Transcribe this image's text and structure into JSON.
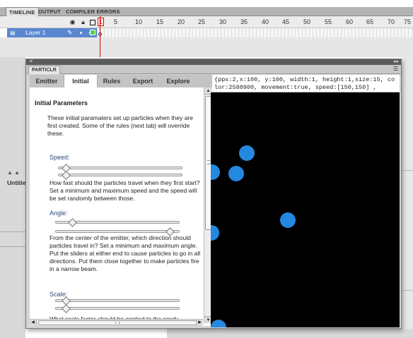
{
  "app": {
    "tabs": [
      "TIMELINE",
      "OUTPUT",
      "COMPILER ERRORS"
    ],
    "frame_numbers": [
      "1",
      "5",
      "10",
      "15",
      "20",
      "25",
      "30",
      "35",
      "40",
      "45",
      "50",
      "55",
      "60",
      "65",
      "70",
      "75"
    ],
    "layer_name": "Layer 1",
    "layer_color": "#4ed04e",
    "left_tab": "Untitle"
  },
  "window": {
    "tab_label": "PARTICLR",
    "nav_tabs": [
      "Emitter",
      "Initial",
      "Rules",
      "Export",
      "Explore"
    ],
    "active_tab": "Initial",
    "section_title": "Initial Parameters",
    "intro": "These initial paramaters set up particles when they are first created.  Some of the rules (next tab) will override these.",
    "speed": {
      "label": "Speed:",
      "description": "How fast should the particles travel when they first start?  Set a minimum and maximum speed and the speed will be set randomly between those."
    },
    "angle": {
      "label": "Angle:",
      "description": "From the center of the emitter, which direction should particles travel in?  Set a minimum and maximum angle.  Put the sliders at either end to cause particles to go in all directions.  Put them close together to make particles fire in a narrow beam."
    },
    "scale": {
      "label": "Scale:",
      "description": "What scale factor should be applied to the newly"
    },
    "code_output": "{pps:2,x:100, y:100, width:1, height:1,size:15, color:2588900, movement:true, speed:[150,150] ,",
    "particle_color": "#2588e0",
    "stage_color": "#000000"
  }
}
